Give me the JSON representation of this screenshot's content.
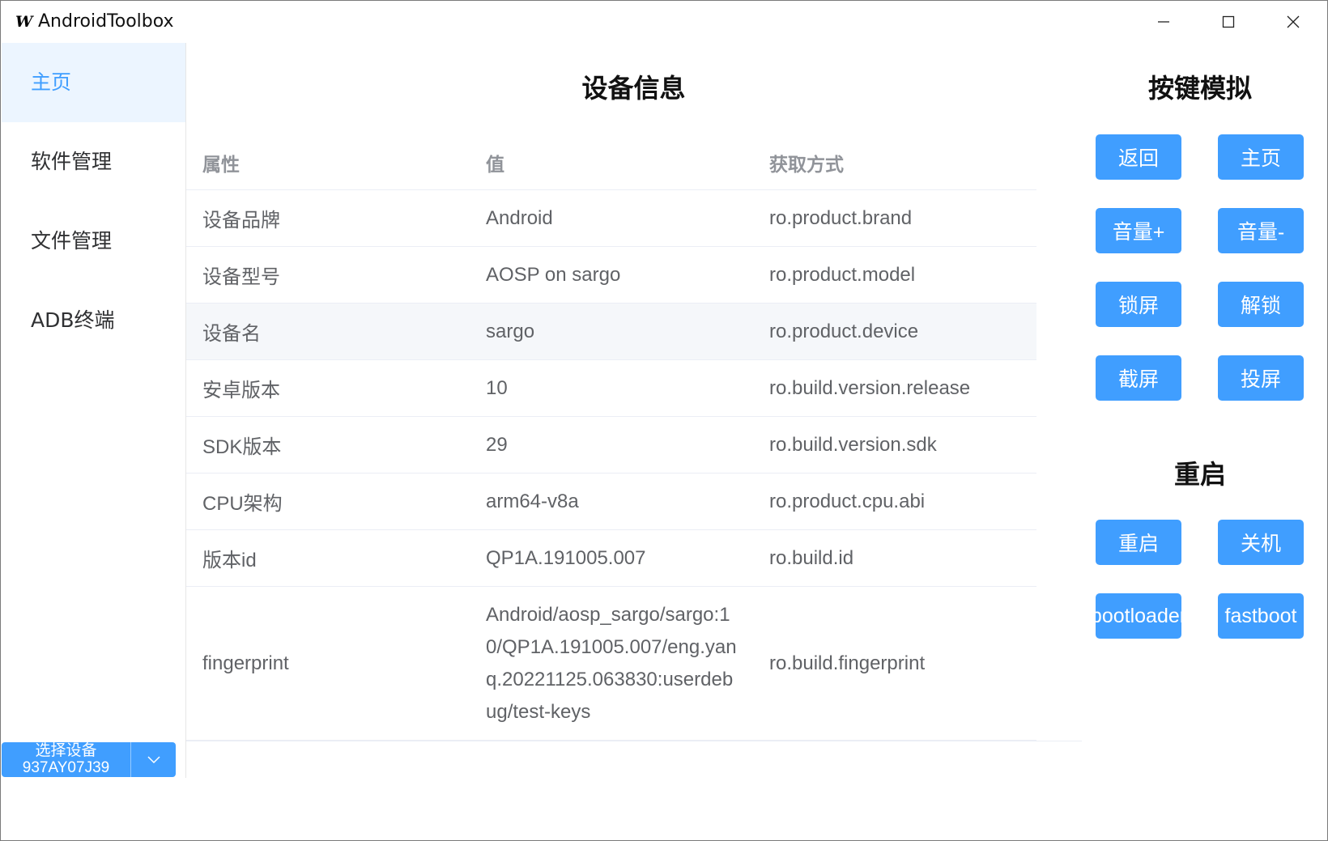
{
  "window": {
    "title": "AndroidToolbox",
    "app_icon_glyph": "W"
  },
  "sidebar": {
    "items": [
      {
        "label": "主页",
        "active": true
      },
      {
        "label": "软件管理",
        "active": false
      },
      {
        "label": "文件管理",
        "active": false
      },
      {
        "label": "ADB终端",
        "active": false
      }
    ],
    "device_select": {
      "label": "选择设备",
      "value": "937AY07J39"
    }
  },
  "device_info": {
    "title": "设备信息",
    "columns": [
      "属性",
      "值",
      "获取方式"
    ],
    "rows": [
      {
        "attr": "设备品牌",
        "value": "Android",
        "source": "ro.product.brand"
      },
      {
        "attr": "设备型号",
        "value": "AOSP on sargo",
        "source": "ro.product.model"
      },
      {
        "attr": "设备名",
        "value": "sargo",
        "source": "ro.product.device"
      },
      {
        "attr": "安卓版本",
        "value": "10",
        "source": "ro.build.version.release"
      },
      {
        "attr": "SDK版本",
        "value": "29",
        "source": "ro.build.version.sdk"
      },
      {
        "attr": "CPU架构",
        "value": "arm64-v8a",
        "source": "ro.product.cpu.abi"
      },
      {
        "attr": "版本id",
        "value": "QP1A.191005.007",
        "source": "ro.build.id"
      },
      {
        "attr": "fingerprint",
        "value": "Android/aosp_sargo/sargo:10/QP1A.191005.007/eng.yanq.20221125.063830:userdebug/test-keys",
        "source": "ro.build.fingerprint"
      }
    ],
    "hovered_row": 2
  },
  "key_sim": {
    "title": "按键模拟",
    "buttons": [
      "返回",
      "主页",
      "音量+",
      "音量-",
      "锁屏",
      "解锁",
      "截屏",
      "投屏"
    ]
  },
  "reboot": {
    "title": "重启",
    "buttons": [
      "重启",
      "关机",
      "bootloader",
      "fastboot"
    ]
  },
  "colors": {
    "primary": "#409eff",
    "active_bg": "#ecf5ff",
    "hover_row_bg": "#f5f7fa"
  }
}
